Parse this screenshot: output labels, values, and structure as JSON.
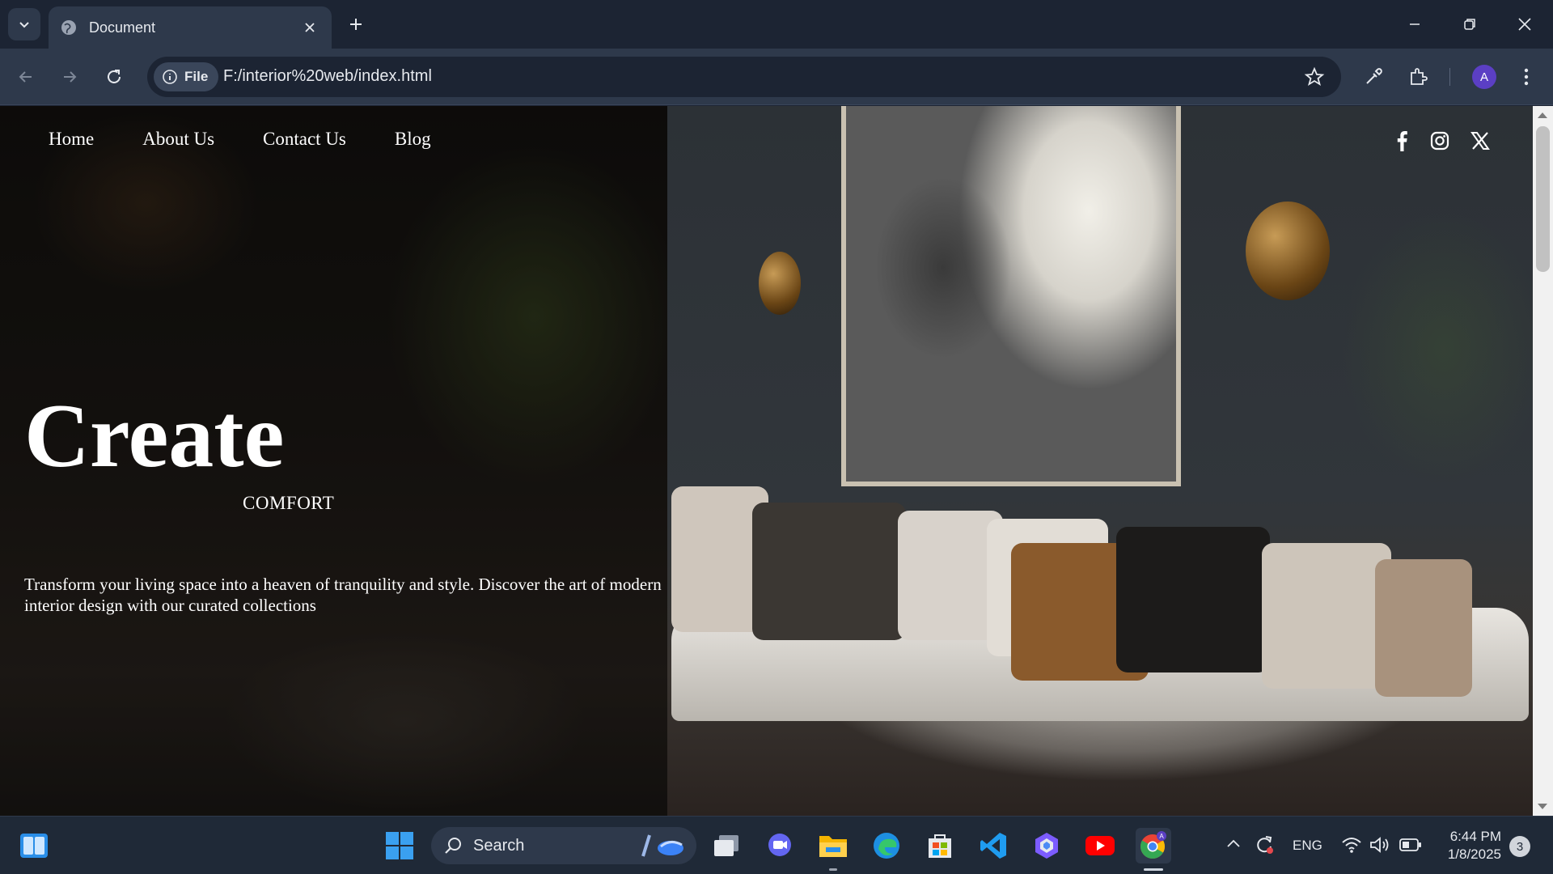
{
  "browser": {
    "tab_title": "Document",
    "address_chip": "File",
    "url": "F:/interior%20web/index.html",
    "profile_initial": "A"
  },
  "site": {
    "nav": [
      "Home",
      "About Us",
      "Contact Us",
      "Blog"
    ],
    "social": [
      "facebook-icon",
      "instagram-icon",
      "x-icon"
    ],
    "hero_title": "Create",
    "hero_subtitle": "COMFORT",
    "hero_description": "Transform your living space into a heaven of tranquility and style. Discover the art of modern interior design with our curated collections"
  },
  "taskbar": {
    "search_label": "Search",
    "language": "ENG",
    "time": "6:44 PM",
    "date": "1/8/2025",
    "notification_count": "3"
  },
  "colors": {
    "chrome_bg": "#1c2433",
    "toolbar_bg": "#2e394b",
    "taskbar_bg": "#1f2937",
    "avatar": "#5b3fc4"
  }
}
